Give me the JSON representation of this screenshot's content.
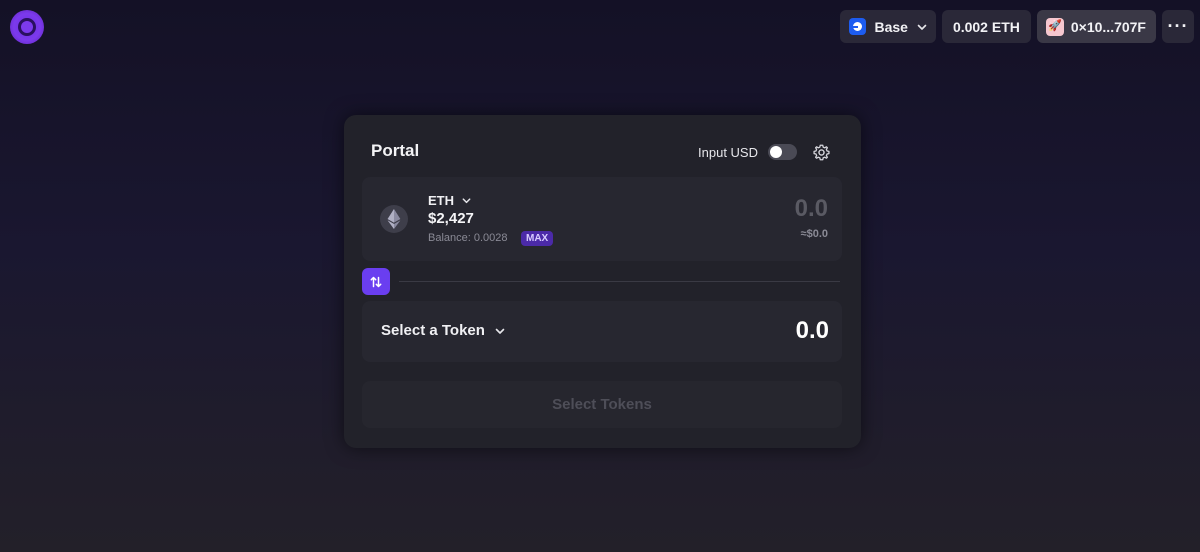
{
  "header": {
    "network": {
      "label": "Base",
      "icon": "base-network-icon"
    },
    "balance": "0.002 ETH",
    "address": {
      "label": "0×10...707F",
      "avatar": "rocket-avatar-icon"
    },
    "more_icon": "more-horizontal-icon",
    "more_label": "···"
  },
  "card": {
    "title": "Portal",
    "input_usd_label": "Input USD",
    "input_usd_enabled": false,
    "settings_icon": "gear-icon",
    "from": {
      "token": "ETH",
      "price": "$2,427",
      "balance": "Balance: 0.0028",
      "max_label": "MAX",
      "amount": "0.0",
      "usd_equiv": "≈$0.0"
    },
    "to": {
      "select_label": "Select a Token",
      "amount": "0.0"
    },
    "submit_label": "Select Tokens"
  },
  "colors": {
    "accent": "#6a3ef0",
    "card_bg": "#22222a",
    "panel_bg": "#272730",
    "max_badge": "#4b2aa8"
  }
}
